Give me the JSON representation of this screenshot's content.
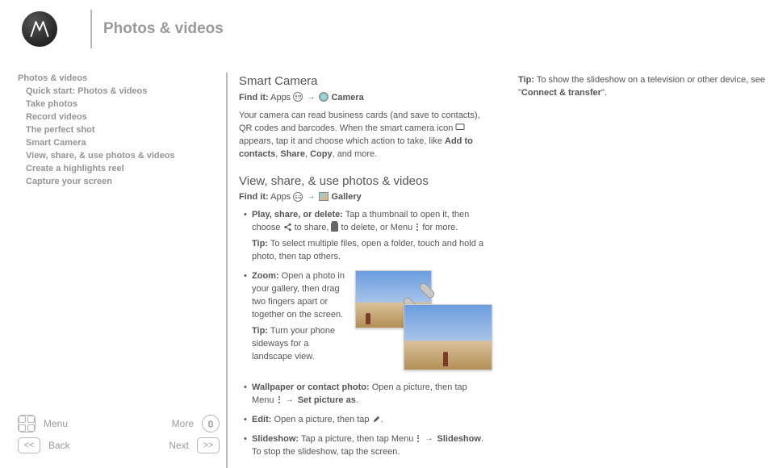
{
  "page_title": "Photos & videos",
  "toc": {
    "root": "Photos & videos",
    "items": [
      "Quick start: Photos & videos",
      "Take photos",
      "Record videos",
      "The perfect shot",
      "Smart Camera",
      "View, share, & use photos & videos",
      "Create a highlights reel",
      "Capture your screen"
    ]
  },
  "nav": {
    "menu": "Menu",
    "more": "More",
    "back": "Back",
    "next": "Next"
  },
  "smart_camera": {
    "heading": "Smart Camera",
    "findit_prefix": "Find it:",
    "findit_apps": "Apps",
    "findit_target": "Camera",
    "body_1": "Your camera can read business cards (and save to contacts), QR codes and barcodes. When the smart camera icon",
    "body_2": "appears, tap it and choose which action to take, like ",
    "body_bold": "Add to contacts",
    "body_3": ", ",
    "body_bold2": "Share",
    "body_4": ", ",
    "body_bold3": "Copy",
    "body_5": ", and more."
  },
  "view_share": {
    "heading": "View, share, & use photos & videos",
    "findit_prefix": "Find it:",
    "findit_apps": "Apps",
    "findit_target": "Gallery",
    "b1_bold": "Play, share, or delete:",
    "b1_a": " Tap a thumbnail to open it, then choose ",
    "b1_b": " to share, ",
    "b1_c": " to delete, or Menu ",
    "b1_d": " for more.",
    "b1_tip_bold": "Tip:",
    "b1_tip": " To select multiple files, open a folder, touch and hold a photo, then tap others.",
    "b2_bold": "Zoom:",
    "b2_text": " Open a photo in your gallery, then drag two fingers apart or together on the screen.",
    "b2_tip_bold": "Tip:",
    "b2_tip": " Turn your phone sideways for a landscape view.",
    "b3_bold": "Wallpaper or contact photo:",
    "b3_a": " Open a picture, then tap Menu ",
    "b3_arrow_target": "Set picture as",
    "b3_end": ".",
    "b4_bold": "Edit:",
    "b4_text": " Open a picture, then tap ",
    "b4_end": ".",
    "b5_bold": "Slideshow:",
    "b5_a": " Tap a picture, then tap Menu ",
    "b5_target": "Slideshow",
    "b5_b": ". To stop the slideshow, tap the screen."
  },
  "col2": {
    "tip_bold": "Tip:",
    "tip_a": " To show the slideshow on a television or other device, see \"",
    "tip_link": "Connect & transfer",
    "tip_b": "\"."
  }
}
